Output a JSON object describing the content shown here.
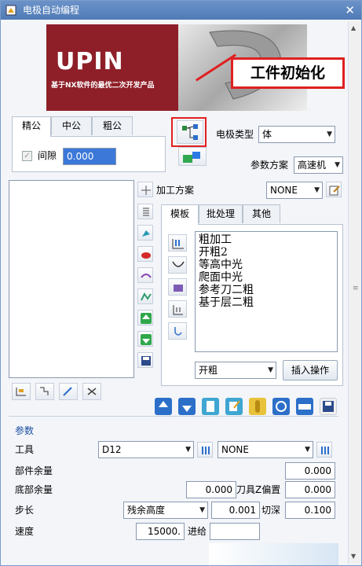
{
  "window": {
    "title": "电极自动编程",
    "close": "✕"
  },
  "banner": {
    "logo": "UPIN",
    "slogan": "基于NX软件的最优二次开发产品"
  },
  "callout": {
    "text": "工件初始化"
  },
  "left_tabs": [
    {
      "label": "精公"
    },
    {
      "label": "中公"
    },
    {
      "label": "粗公"
    }
  ],
  "gap": {
    "label": "间隙",
    "value": "0.000",
    "checked": true
  },
  "electrode_type": {
    "label": "电极类型",
    "value": "体"
  },
  "param_scheme": {
    "label": "参数方案",
    "value": "高速机"
  },
  "machining_scheme": {
    "label": "加工方案",
    "value": "NONE"
  },
  "right_tabs": [
    {
      "label": "模板"
    },
    {
      "label": "批处理"
    },
    {
      "label": "其他"
    }
  ],
  "templates": [
    "粗加工",
    "开粗2",
    "等高中光",
    "爬面中光",
    "参考刀二粗",
    "基于层二粗"
  ],
  "op_select": {
    "value": "开粗"
  },
  "insert_button": {
    "label": "插入操作"
  },
  "params": {
    "title": "参数",
    "tool": {
      "label": "工具",
      "value": "D12",
      "second_value": "NONE"
    },
    "part_stock": {
      "label": "部件余量",
      "value": "0.000"
    },
    "floor_stock": {
      "label": "底部余量",
      "value": "0.000"
    },
    "tool_z_offset": {
      "label": "刀具Z偏置",
      "value": "0.000"
    },
    "stepover": {
      "label": "步长",
      "mode": "残余高度",
      "value": "0.001"
    },
    "cut_depth": {
      "label": "切深",
      "value": "0.100"
    },
    "speed": {
      "label": "速度",
      "value": "15000."
    },
    "feed": {
      "label": "进给",
      "value": ""
    }
  },
  "colors": {
    "accent": "#1a4fa0",
    "highlight": "#e02020",
    "banner": "#8e1f28"
  }
}
